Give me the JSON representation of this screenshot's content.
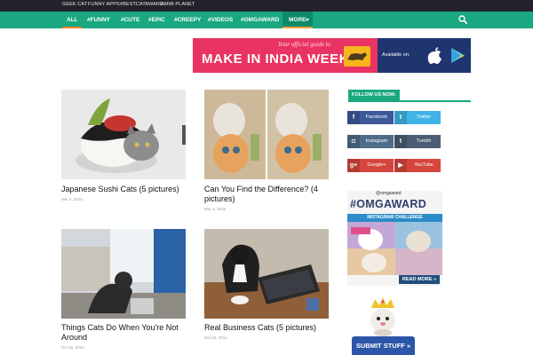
{
  "topbar": {
    "links": [
      "GEEK CAT",
      "FUNNY APPS",
      "#BESTCATAWARD",
      "AMMI PLANET"
    ]
  },
  "nav": {
    "items": [
      "ALL",
      "#FUNNY",
      "#CUTE",
      "#EPIC",
      "#CREEPY",
      "#VIDEOS",
      "#OMGAWARD",
      "MORE"
    ],
    "active": "ALL",
    "search_icon": "search-icon",
    "colors": {
      "bar": "#1aa881",
      "active_underline": "#ff7f2a",
      "top": "#22232a"
    }
  },
  "banner": {
    "tagline": "Your official guide to",
    "headline": "MAKE IN INDIA WEEK",
    "available": "Available on:",
    "icons": [
      "apple-icon",
      "google-play-icon"
    ]
  },
  "posts": [
    {
      "title": "Japanese Sushi Cats (5 pictures)",
      "date": "Mar 9, 2015"
    },
    {
      "title": "Can You Find the Difference? (4 pictures)",
      "date": "Mar 9, 2015"
    },
    {
      "title": "Things Cats Do When You're Not Around",
      "date": "Oct 26, 2014"
    },
    {
      "title": "Real Business Cats (5 pictures)",
      "date": "Oct 26, 2014"
    }
  ],
  "sidebar": {
    "follow_label": "FOLLOW US NOW:",
    "social": [
      {
        "label": "Facebook",
        "icon": "facebook-icon",
        "glyph": "f",
        "color": "#3b5998"
      },
      {
        "label": "Twitter",
        "icon": "twitter-icon",
        "glyph": "t",
        "color": "#40b3e7"
      },
      {
        "label": "Instagram",
        "icon": "instagram-icon",
        "glyph": "◘",
        "color": "#4d6d8b"
      },
      {
        "label": "Tumblr",
        "icon": "tumblr-icon",
        "glyph": "t",
        "color": "#4a5d74"
      },
      {
        "label": "Google+",
        "icon": "google-plus-icon",
        "glyph": "g+",
        "color": "#d6453d"
      },
      {
        "label": "YouTube",
        "icon": "youtube-icon",
        "glyph": "▶",
        "color": "#d6453d"
      }
    ],
    "promo": {
      "handle": "@omgaward",
      "title": "#OMGAWARD",
      "subtitle": "INSTAGRAM CHALLENGE",
      "more": "READ MORE »"
    },
    "submit": "SUBMIT STUFF »"
  }
}
